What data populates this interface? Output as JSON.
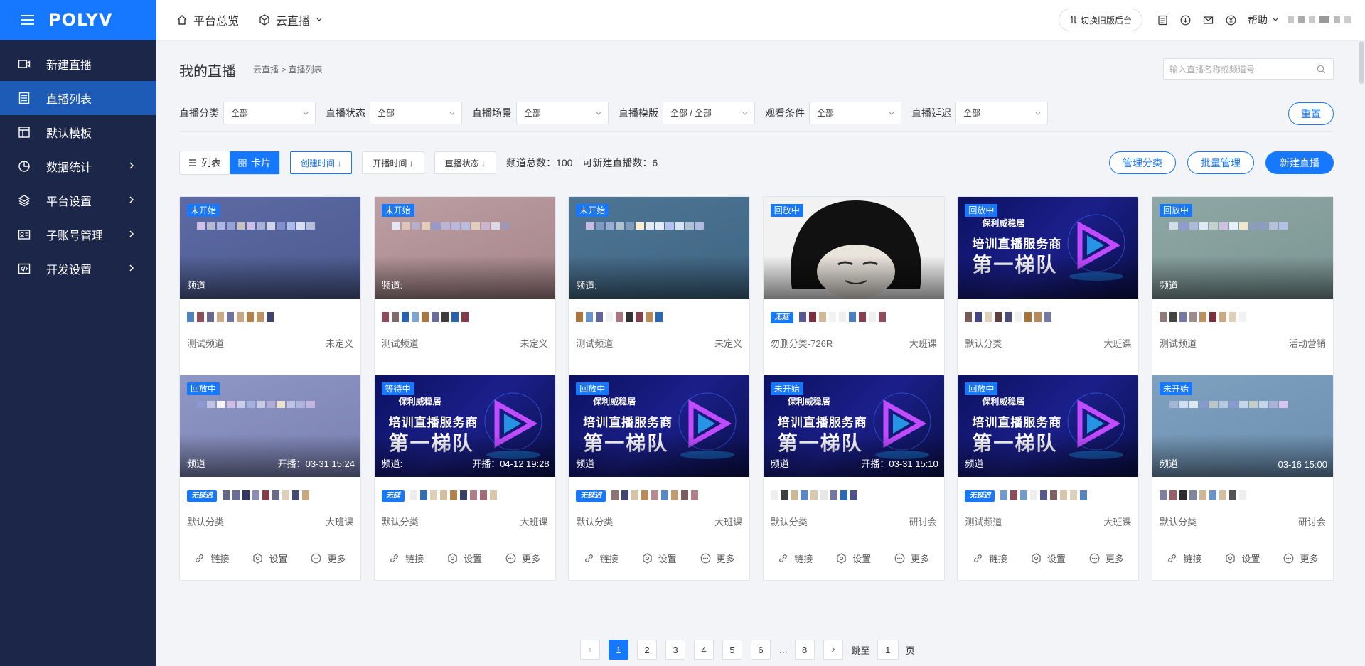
{
  "brand": "POLYV",
  "colors": {
    "accent": "#1677ff",
    "sidebar": "#1b2649",
    "active_nav": "#1d5bb6"
  },
  "sidebar": {
    "items": [
      {
        "label": "新建直播",
        "icon": "video-camera-icon"
      },
      {
        "label": "直播列表",
        "icon": "list-icon",
        "active": true
      },
      {
        "label": "默认模板",
        "icon": "layout-icon"
      },
      {
        "label": "数据统计",
        "icon": "pie-chart-icon",
        "has_children": true
      },
      {
        "label": "平台设置",
        "icon": "layers-icon",
        "has_children": true
      },
      {
        "label": "子账号管理",
        "icon": "id-card-icon",
        "has_children": true
      },
      {
        "label": "开发设置",
        "icon": "code-icon",
        "has_children": true
      }
    ]
  },
  "topbar": {
    "overview": "平台总览",
    "cloud_live": "云直播",
    "switch_label": "切换旧版后台",
    "help": "帮助"
  },
  "page": {
    "title": "我的直播",
    "breadcrumb": "云直播 > 直播列表",
    "search_placeholder": "输入直播名称或频道号"
  },
  "filters": [
    {
      "label": "直播分类",
      "value": "全部"
    },
    {
      "label": "直播状态",
      "value": "全部"
    },
    {
      "label": "直播场景",
      "value": "全部"
    },
    {
      "label": "直播模版",
      "value": "全部 / 全部"
    },
    {
      "label": "观看条件",
      "value": "全部"
    },
    {
      "label": "直播延迟",
      "value": "全部"
    }
  ],
  "reset": "重置",
  "toolbar": {
    "list": "列表",
    "card": "卡片",
    "sort_created": "创建时间 ↓",
    "sort_start": "开播时间 ↓",
    "sort_status": "直播状态 ↓",
    "total": "频道总数：100",
    "can_create": "可新建直播数：6",
    "manage_category": "管理分类",
    "batch_manage": "批量管理",
    "new_live": "新建直播"
  },
  "card_actions": {
    "link": "链接",
    "settings": "设置",
    "more": "更多"
  },
  "cards": [
    {
      "status": "未开始",
      "channel": "频道",
      "time": "",
      "category": "测试频道",
      "scene": "未定义",
      "cover": "purple",
      "tag": ""
    },
    {
      "status": "未开始",
      "channel": "频道:",
      "time": "",
      "category": "测试频道",
      "scene": "未定义",
      "cover": "rose",
      "tag": ""
    },
    {
      "status": "未开始",
      "channel": "频道:",
      "time": "",
      "category": "测试频道",
      "scene": "未定义",
      "cover": "steel",
      "tag": ""
    },
    {
      "status": "回放中",
      "channel": "",
      "time": "",
      "category": "勿删分类-726R",
      "scene": "大班课",
      "cover": "meme",
      "tag": "无延"
    },
    {
      "status": "回放中",
      "channel": "",
      "time": "",
      "category": "默认分类",
      "scene": "大班课",
      "cover": "promo",
      "tag": ""
    },
    {
      "status": "回放中",
      "channel": "频道",
      "time": "",
      "category": "测试频道",
      "scene": "活动营销",
      "cover": "sage",
      "tag": ""
    },
    {
      "status": "回放中",
      "channel": "频道",
      "time": "开播：03-31 15:24",
      "category": "默认分类",
      "scene": "大班课",
      "cover": "lavender",
      "tag": "无延迟"
    },
    {
      "status": "等待中",
      "channel": "频道:",
      "time": "开播：04-12 19:28",
      "category": "默认分类",
      "scene": "大班课",
      "cover": "promo",
      "tag": "无延"
    },
    {
      "status": "回放中",
      "channel": "频道",
      "time": "",
      "category": "默认分类",
      "scene": "大班课",
      "cover": "promo",
      "tag": "无延迟"
    },
    {
      "status": "未开始",
      "channel": "频道",
      "time": "开播：03-31 15:10",
      "category": "默认分类",
      "scene": "研讨会",
      "cover": "promo",
      "tag": ""
    },
    {
      "status": "回放中",
      "channel": "频道",
      "time": "",
      "category": "测试频道",
      "scene": "大班课",
      "cover": "promo",
      "tag": "无延迟"
    },
    {
      "status": "未开始",
      "channel": "频道",
      "time": "03-16 15:00",
      "category": "默认分类",
      "scene": "研讨会",
      "cover": "skyblue",
      "tag": ""
    }
  ],
  "promo": {
    "line1": "保利威稳居",
    "line2": "培训直播服务商",
    "line3": "第一梯队"
  },
  "pagination": {
    "pages": [
      "1",
      "2",
      "3",
      "4",
      "5",
      "6",
      "...",
      "8"
    ],
    "current": "1",
    "jump_label": "跳至",
    "jump_value": "1",
    "page_suffix": "页"
  }
}
